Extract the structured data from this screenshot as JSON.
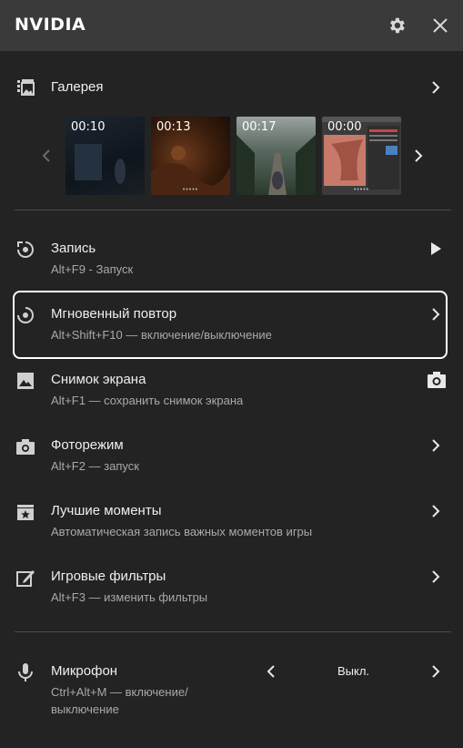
{
  "header": {
    "title": "NVIDIA",
    "settings_icon": "gear-icon",
    "close_icon": "close-icon"
  },
  "gallery": {
    "label": "Галерея",
    "thumbnails": [
      {
        "duration": "00:10"
      },
      {
        "duration": "00:13"
      },
      {
        "duration": "00:17"
      },
      {
        "duration": "00:00"
      }
    ]
  },
  "items": {
    "record": {
      "title": "Запись",
      "sub": "Alt+F9 - Запуск"
    },
    "instant_replay": {
      "title": "Мгновенный повтор",
      "sub": "Alt+Shift+F10 — включение/выключение"
    },
    "screenshot": {
      "title": "Снимок экрана",
      "sub": "Alt+F1 — сохранить снимок экрана"
    },
    "photo_mode": {
      "title": "Фоторежим",
      "sub": "Alt+F2 — запуск"
    },
    "highlights": {
      "title": "Лучшие моменты",
      "sub": "Автоматическая запись важных моментов игры"
    },
    "filters": {
      "title": "Игровые фильтры",
      "sub": "Alt+F3 — изменить фильтры"
    },
    "microphone": {
      "title": "Микрофон",
      "sub_line1": "Ctrl+Alt+M — включение/",
      "sub_line2": "выключение",
      "value": "Выкл."
    }
  },
  "colors": {
    "header_bg": "#3a3a3a",
    "panel_bg": "#232323",
    "highlight_border": "#ffffff"
  }
}
